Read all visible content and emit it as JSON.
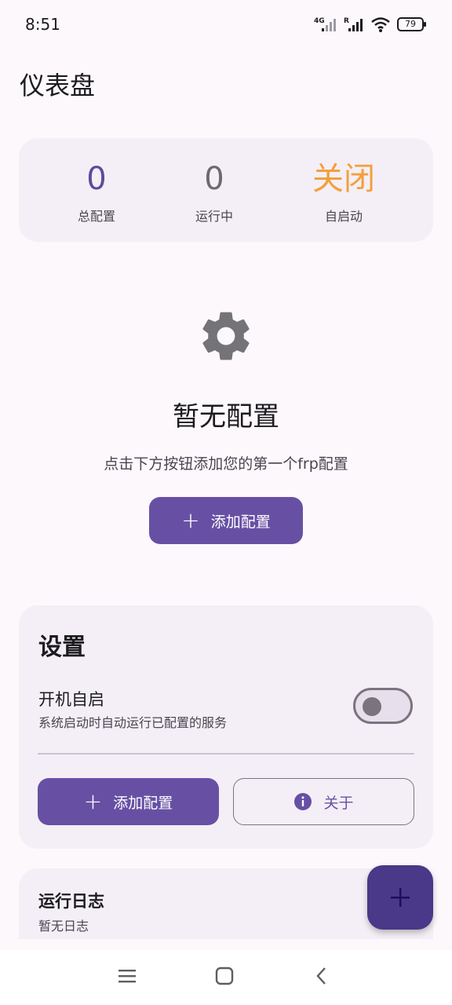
{
  "status_bar": {
    "time": "8:51",
    "network": "4G",
    "roaming": "R",
    "battery": "79"
  },
  "page": {
    "title": "仪表盘"
  },
  "stats": [
    {
      "value": "0",
      "label": "总配置",
      "color": "#5e4b9c"
    },
    {
      "value": "0",
      "label": "运行中",
      "color": "#6b6a70"
    },
    {
      "value": "关闭",
      "label": "自启动",
      "color": "#f2a03d"
    }
  ],
  "empty_state": {
    "icon": "gear-icon",
    "title": "暂无配置",
    "description": "点击下方按钮添加您的第一个frp配置",
    "button_label": "添加配置"
  },
  "settings": {
    "title": "设置",
    "autostart": {
      "label": "开机自启",
      "description": "系统启动时自动运行已配置的服务",
      "enabled": false
    },
    "add_button_label": "添加配置",
    "about_button_label": "关于"
  },
  "logs": {
    "title": "运行日志",
    "empty": "暂无日志"
  },
  "fab": {
    "icon": "plus-icon"
  },
  "colors": {
    "primary": "#6750a4",
    "fab": "#4a3888",
    "accent_orange": "#f2a03d"
  }
}
